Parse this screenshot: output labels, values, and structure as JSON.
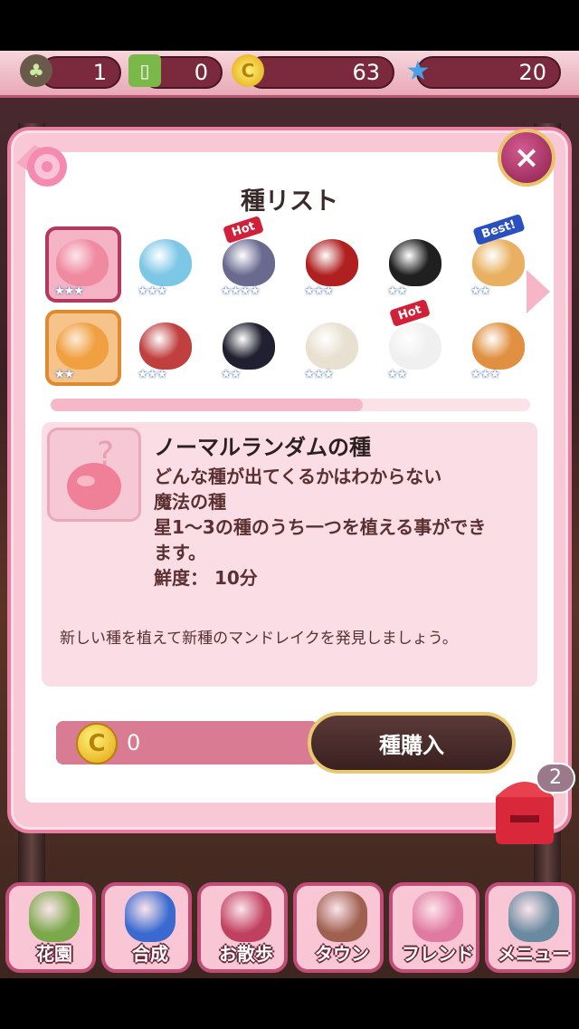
{
  "status": {
    "seeds": "1",
    "tickets": "0",
    "coins": "63",
    "stars": "20"
  },
  "dialog": {
    "title": "種リスト",
    "close_label": "×"
  },
  "seeds": [
    {
      "tag": "",
      "stars": "★★★",
      "color": "#f08aa0"
    },
    {
      "tag": "",
      "stars": "★★★",
      "color": "#7cc6e6"
    },
    {
      "tag": "Hot",
      "stars": "★★★★",
      "color": "#6a6a90"
    },
    {
      "tag": "",
      "stars": "★★★",
      "color": "#b02020"
    },
    {
      "tag": "",
      "stars": "★★",
      "color": "#202020"
    },
    {
      "tag": "Best!",
      "stars": "★★",
      "color": "#e8b060"
    },
    {
      "tag": "",
      "stars": "★★",
      "color": "#f0a040"
    },
    {
      "tag": "",
      "stars": "★★★",
      "color": "#c04040"
    },
    {
      "tag": "",
      "stars": "★★",
      "color": "#202030"
    },
    {
      "tag": "",
      "stars": "★★★",
      "color": "#e8e0d0"
    },
    {
      "tag": "Hot",
      "stars": "★★",
      "color": "#f0f0f0"
    },
    {
      "tag": "",
      "stars": "★★★",
      "color": "#e09040"
    }
  ],
  "progress_fraction": 0.65,
  "detail": {
    "name": "ノーマルランダムの種",
    "lines": [
      "どんな種が出てくるかはわからない",
      "魔法の種",
      "星1〜3の種のうち一つを植える事ができ",
      "ます。",
      "鮮度： 10分"
    ],
    "hint": "新しい種を植えて新種のマンドレイクを発見しましょう。"
  },
  "purchase": {
    "coin_icon": "C",
    "quantity": "0",
    "buy_label": "種購入"
  },
  "mailbox": {
    "badge": "2"
  },
  "nav": [
    {
      "label": "花園",
      "icon": "flower-pot-icon"
    },
    {
      "label": "合成",
      "icon": "potion-icon"
    },
    {
      "label": "お散歩",
      "icon": "map-pin-icon"
    },
    {
      "label": "タウン",
      "icon": "castle-icon"
    },
    {
      "label": "フレンド",
      "icon": "friends-icon"
    },
    {
      "label": "メニュー",
      "icon": "menu-board-icon"
    }
  ],
  "colors": {
    "accent": "#c04c78",
    "panel_pink": "#f9c8d6",
    "tag_hot": "#d0203a",
    "tag_best": "#2a50c0"
  }
}
